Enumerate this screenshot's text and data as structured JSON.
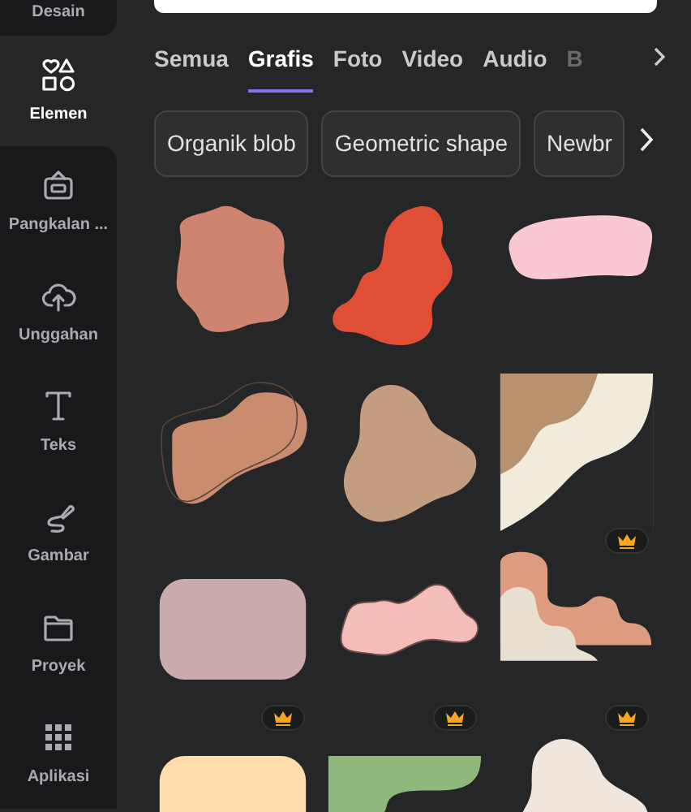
{
  "sidebar": {
    "items": [
      {
        "label": "Desain",
        "selected": false
      },
      {
        "label": "Elemen",
        "selected": true
      },
      {
        "label": "Pangkalan ...",
        "selected": false
      },
      {
        "label": "Unggahan",
        "selected": false
      },
      {
        "label": "Teks",
        "selected": false
      },
      {
        "label": "Gambar",
        "selected": false
      },
      {
        "label": "Proyek",
        "selected": false
      },
      {
        "label": "Aplikasi",
        "selected": false
      }
    ]
  },
  "tabs": [
    {
      "label": "Semua",
      "selected": false
    },
    {
      "label": "Grafis",
      "selected": true
    },
    {
      "label": "Foto",
      "selected": false
    },
    {
      "label": "Video",
      "selected": false
    },
    {
      "label": "Audio",
      "selected": false
    },
    {
      "label": "B",
      "selected": false
    }
  ],
  "chips": [
    "Organik blob",
    "Geometric shape",
    "Newbr"
  ],
  "graphics": [
    {
      "kind": "star-blob",
      "color": "#cf8470",
      "premium": false
    },
    {
      "kind": "tall-blob",
      "color": "#e04e35",
      "premium": false
    },
    {
      "kind": "wide-blob",
      "color": "#f9c8d3",
      "premium": false
    },
    {
      "kind": "outlined-blob",
      "color": "#c98c6e",
      "premium": false
    },
    {
      "kind": "round-blob",
      "color": "#c49c80",
      "premium": false
    },
    {
      "kind": "corner-wave",
      "color": "#b8916e",
      "premium": true
    },
    {
      "kind": "rounded-rect",
      "color": "#c9aaad",
      "premium": true
    },
    {
      "kind": "cloud",
      "color": "#f4bdb8",
      "premium": true
    },
    {
      "kind": "step-wave",
      "color": "#dd9c80",
      "premium": true
    },
    {
      "kind": "rounded-rect",
      "color": "#ffdcaa",
      "premium": false
    },
    {
      "kind": "green-corner",
      "color": "#8fb87c",
      "premium": false
    },
    {
      "kind": "round-blob",
      "color": "#f0e6dd",
      "premium": false
    }
  ]
}
